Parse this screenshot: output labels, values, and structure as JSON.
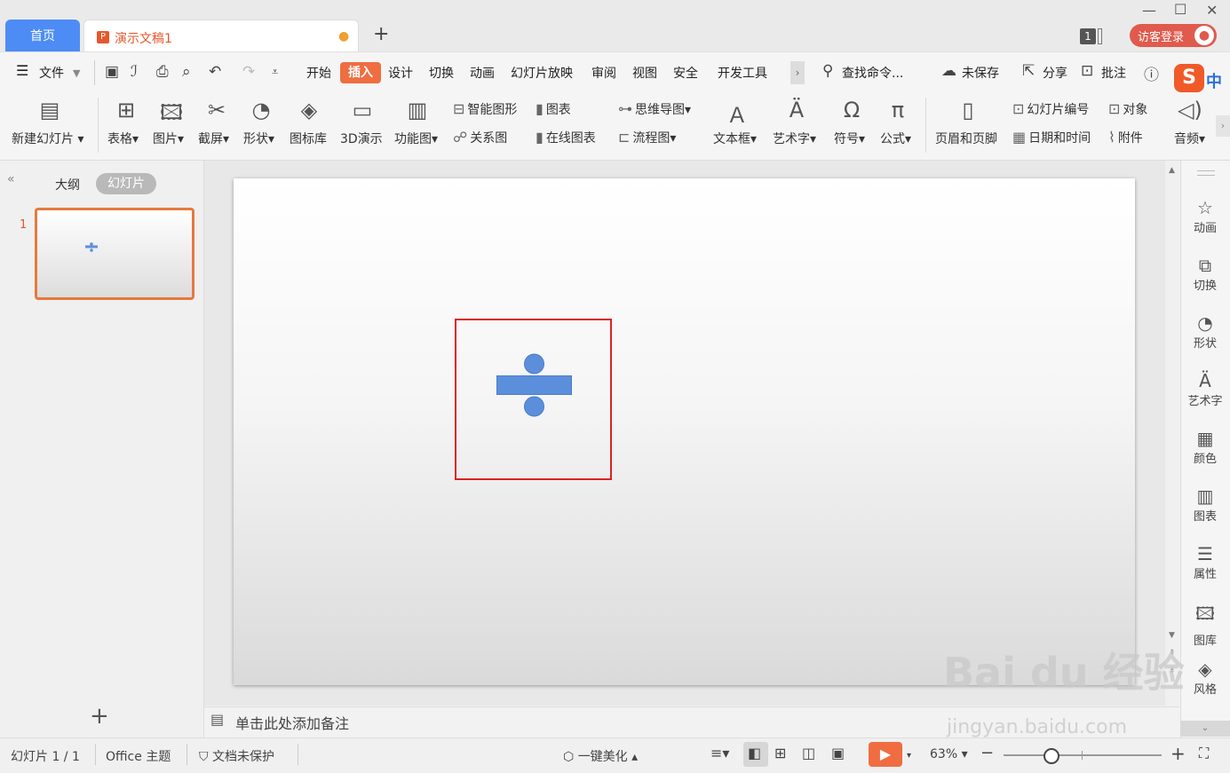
{
  "titlebar": {
    "home_tab": "首页",
    "doc_tab": "演示文稿1",
    "doc_badge": "P",
    "unsaved_dot": "●",
    "new_tab": "+",
    "window_count": "1",
    "login": "访客登录"
  },
  "menubar": {
    "file": "文件",
    "items": [
      "开始",
      "插入",
      "设计",
      "切换",
      "动画",
      "幻灯片放映",
      "审阅",
      "视图",
      "安全",
      "开发工具"
    ],
    "search": "查找命令...",
    "unsaved": "未保存",
    "share": "分享",
    "comment": "批注"
  },
  "ribbon": {
    "new_slide": "新建幻灯片",
    "table": "表格",
    "picture": "图片",
    "screenshot": "截屏",
    "shape": "形状",
    "icon_lib": "图标库",
    "demo3d": "3D演示",
    "func_chart": "功能图",
    "smart_art": "智能图形",
    "chart": "图表",
    "mindmap": "思维导图",
    "relation": "关系图",
    "online_chart": "在线图表",
    "flowchart": "流程图",
    "textbox": "文本框",
    "wordart": "艺术字",
    "symbol": "符号",
    "formula": "公式",
    "header_footer": "页眉和页脚",
    "slide_number": "幻灯片编号",
    "object": "对象",
    "date_time": "日期和时间",
    "attachment": "附件",
    "audio": "音频"
  },
  "leftpanel": {
    "outline": "大纲",
    "slides": "幻灯片",
    "thumb_number": "1"
  },
  "notes": "单击此处添加备注",
  "rightrail": [
    "动画",
    "切换",
    "形状",
    "艺术字",
    "颜色",
    "图表",
    "属性",
    "图库",
    "风格"
  ],
  "statusbar": {
    "slide_count": "幻灯片 1 / 1",
    "theme": "Office 主题",
    "protect": "文档未保护",
    "beautify": "一键美化",
    "zoom": "63%"
  },
  "watermark": {
    "main": "Bai du 经验",
    "sub": "jingyan.baidu.com"
  },
  "colors": {
    "accent": "#ef6d40",
    "home_tab": "#4d8cf5",
    "shape_fill": "#5b8fdc",
    "selection": "#e02020"
  }
}
